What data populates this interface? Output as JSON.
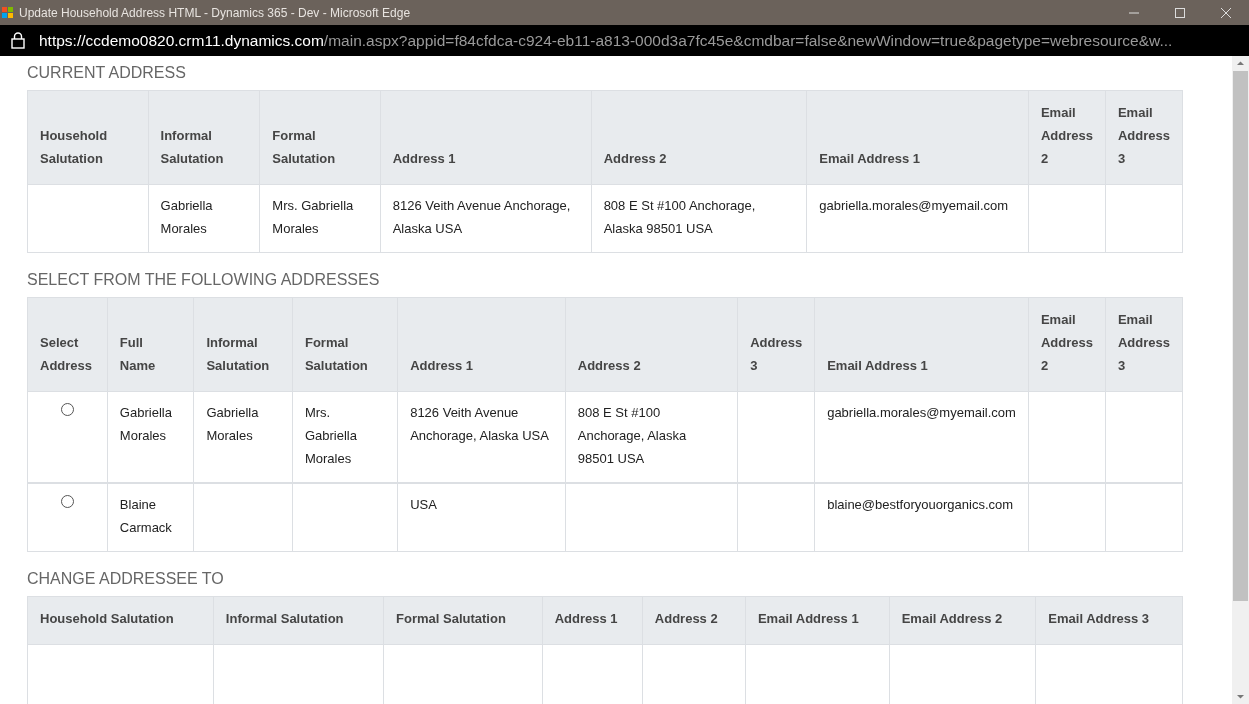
{
  "window": {
    "title": "Update Household Address HTML - Dynamics 365 - Dev - Microsoft Edge"
  },
  "address_bar": {
    "host": "https://ccdemo0820.crm11.dynamics.com",
    "path": "/main.aspx?appid=f84cfdca-c924-eb11-a813-000d3a7fc45e&cmdbar=false&newWindow=true&pagetype=webresource&w..."
  },
  "current_address": {
    "heading": "CURRENT ADDRESS",
    "columns": [
      "Household Salutation",
      "Informal Salutation",
      "Formal Salutation",
      "Address 1",
      "Address 2",
      "Email Address 1",
      "Email Address 2",
      "Email Address 3"
    ],
    "rows": [
      [
        null,
        "Gabriella Morales",
        "Mrs. Gabriella Morales",
        "8126 Veith Avenue Anchorage, Alaska USA",
        "808 E St #100 Anchorage, Alaska 98501 USA",
        "gabriella.morales@myemail.com",
        null,
        null
      ]
    ]
  },
  "address_options": {
    "heading": "SELECT FROM THE FOLLOWING ADDRESSES",
    "columns": [
      "Select Address",
      "Full Name",
      "Informal Salutation",
      "Formal Salutation",
      "Address 1",
      "Address 2",
      "Address 3",
      "Email Address 1",
      "Email Address 2",
      "Email Address 3"
    ],
    "rows": [
      {
        "selected": false,
        "cells": [
          "",
          "Gabriella Morales",
          "Gabriella Morales",
          "Mrs. Gabriella Morales",
          "8126 Veith Avenue Anchorage, Alaska USA",
          "808 E St #100 Anchorage, Alaska 98501 USA",
          null,
          "gabriella.morales@myemail.com",
          null,
          null
        ]
      },
      {
        "selected": false,
        "cells": [
          "",
          "Blaine Carmack",
          null,
          null,
          "USA",
          null,
          null,
          "blaine@bestforyouorganics.com",
          null,
          null
        ]
      }
    ]
  },
  "change_addressee": {
    "heading": "CHANGE ADDRESSEE TO",
    "columns": [
      "Household Salutation",
      "Informal Salutation",
      "Formal Salutation",
      "Address 1",
      "Address 2",
      "Email Address 1",
      "Email Address 2",
      "Email Address 3"
    ]
  }
}
